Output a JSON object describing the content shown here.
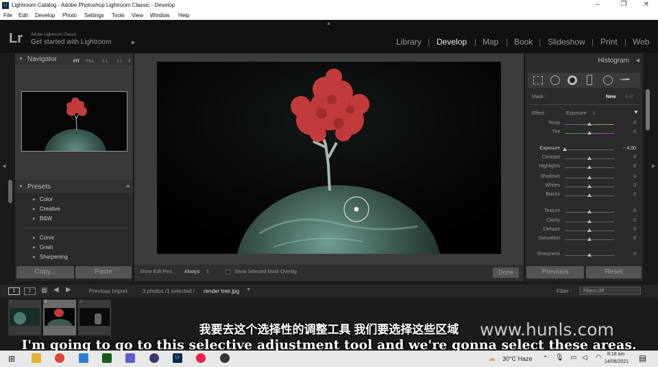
{
  "window": {
    "title": "Lightroom Catalog - Adobe Photoshop Lightroom Classic - Develop",
    "app_icon": "Lr"
  },
  "menubar": [
    "File",
    "Edit",
    "Develop",
    "Photo",
    "Settings",
    "Tools",
    "View",
    "Window",
    "Help"
  ],
  "identity": {
    "logo": "Lr",
    "line1": "Adobe Lightroom Classic",
    "line2": "Get started with Lightroom"
  },
  "modules": [
    "Library",
    "Develop",
    "Map",
    "Book",
    "Slideshow",
    "Print",
    "Web"
  ],
  "active_module": "Develop",
  "navigator": {
    "title": "Navigator",
    "options": [
      "FIT",
      "FILL",
      "1:1",
      "3:1"
    ]
  },
  "presets": {
    "title": "Presets",
    "groups": [
      "Color",
      "Creative",
      "B&W",
      "Curve",
      "Grain",
      "Sharpening"
    ]
  },
  "left_buttons": {
    "copy": "Copy...",
    "paste": "Paste"
  },
  "toolbar": {
    "show_edit_pins_label": "Show Edit Pins :",
    "show_edit_pins_value": "Always",
    "overlay_label": "Show Selected Mask Overlay",
    "done": "Done"
  },
  "right_panel": {
    "histogram": "Histogram",
    "mask_label": "Mask :",
    "mask_new": "New",
    "mask_edit": "Edit",
    "effect_label": "Effect :",
    "effect_value": "Exposure",
    "sliders": [
      {
        "label": "Temp",
        "value": "0",
        "pos": 0.5
      },
      {
        "label": "Tint",
        "value": "0",
        "pos": 0.5
      },
      {
        "label": "Exposure",
        "value": "− 4.00",
        "pos": 0.0
      },
      {
        "label": "Contrast",
        "value": "0",
        "pos": 0.5
      },
      {
        "label": "Highlights",
        "value": "0",
        "pos": 0.5
      },
      {
        "label": "Shadows",
        "value": "0",
        "pos": 0.5
      },
      {
        "label": "Whites",
        "value": "0",
        "pos": 0.5
      },
      {
        "label": "Blacks",
        "value": "0",
        "pos": 0.5
      },
      {
        "label": "Texture",
        "value": "0",
        "pos": 0.5
      },
      {
        "label": "Clarity",
        "value": "0",
        "pos": 0.5
      },
      {
        "label": "Dehaze",
        "value": "0",
        "pos": 0.5
      },
      {
        "label": "Saturation",
        "value": "0",
        "pos": 0.5
      },
      {
        "label": "Sharpness",
        "value": "0",
        "pos": 0.5
      }
    ],
    "previous": "Previous",
    "reset": "Reset"
  },
  "filmstrip_bar": {
    "view1": "1",
    "view2": "2",
    "source": "Previous Import",
    "count": "3 photos /1 selected /",
    "file": "render tree.jpg",
    "filter_label": "Filter :",
    "filter_value": "Filters Off"
  },
  "thumbs": [
    "1",
    "2",
    "3"
  ],
  "subtitle_cn": "我要去这个选择性的调整工具 我们要选择这些区域",
  "subtitle_en": "I'm going to go to this selective adjustment tool and we're gonna select these areas.",
  "watermark": "www.hunls.com",
  "taskbar": {
    "weather": "30°C  Haze",
    "time": "8:18 am",
    "date": "14/06/2021"
  },
  "colors": {
    "accent": "#ffffff",
    "tree": "#c23b3b",
    "planet": "#3e5a52"
  }
}
